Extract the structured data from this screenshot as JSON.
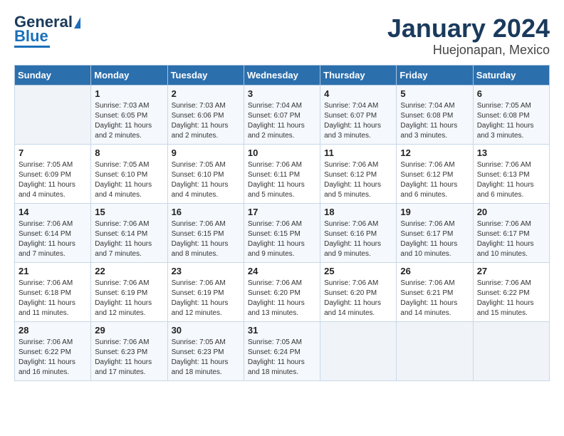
{
  "header": {
    "logo_line1": "General",
    "logo_line2": "Blue",
    "title": "January 2024",
    "subtitle": "Huejonapan, Mexico"
  },
  "calendar": {
    "headers": [
      "Sunday",
      "Monday",
      "Tuesday",
      "Wednesday",
      "Thursday",
      "Friday",
      "Saturday"
    ],
    "weeks": [
      [
        {
          "day": "",
          "info": ""
        },
        {
          "day": "1",
          "info": "Sunrise: 7:03 AM\nSunset: 6:05 PM\nDaylight: 11 hours\nand 2 minutes."
        },
        {
          "day": "2",
          "info": "Sunrise: 7:03 AM\nSunset: 6:06 PM\nDaylight: 11 hours\nand 2 minutes."
        },
        {
          "day": "3",
          "info": "Sunrise: 7:04 AM\nSunset: 6:07 PM\nDaylight: 11 hours\nand 2 minutes."
        },
        {
          "day": "4",
          "info": "Sunrise: 7:04 AM\nSunset: 6:07 PM\nDaylight: 11 hours\nand 3 minutes."
        },
        {
          "day": "5",
          "info": "Sunrise: 7:04 AM\nSunset: 6:08 PM\nDaylight: 11 hours\nand 3 minutes."
        },
        {
          "day": "6",
          "info": "Sunrise: 7:05 AM\nSunset: 6:08 PM\nDaylight: 11 hours\nand 3 minutes."
        }
      ],
      [
        {
          "day": "7",
          "info": "Sunrise: 7:05 AM\nSunset: 6:09 PM\nDaylight: 11 hours\nand 4 minutes."
        },
        {
          "day": "8",
          "info": "Sunrise: 7:05 AM\nSunset: 6:10 PM\nDaylight: 11 hours\nand 4 minutes."
        },
        {
          "day": "9",
          "info": "Sunrise: 7:05 AM\nSunset: 6:10 PM\nDaylight: 11 hours\nand 4 minutes."
        },
        {
          "day": "10",
          "info": "Sunrise: 7:06 AM\nSunset: 6:11 PM\nDaylight: 11 hours\nand 5 minutes."
        },
        {
          "day": "11",
          "info": "Sunrise: 7:06 AM\nSunset: 6:12 PM\nDaylight: 11 hours\nand 5 minutes."
        },
        {
          "day": "12",
          "info": "Sunrise: 7:06 AM\nSunset: 6:12 PM\nDaylight: 11 hours\nand 6 minutes."
        },
        {
          "day": "13",
          "info": "Sunrise: 7:06 AM\nSunset: 6:13 PM\nDaylight: 11 hours\nand 6 minutes."
        }
      ],
      [
        {
          "day": "14",
          "info": "Sunrise: 7:06 AM\nSunset: 6:14 PM\nDaylight: 11 hours\nand 7 minutes."
        },
        {
          "day": "15",
          "info": "Sunrise: 7:06 AM\nSunset: 6:14 PM\nDaylight: 11 hours\nand 7 minutes."
        },
        {
          "day": "16",
          "info": "Sunrise: 7:06 AM\nSunset: 6:15 PM\nDaylight: 11 hours\nand 8 minutes."
        },
        {
          "day": "17",
          "info": "Sunrise: 7:06 AM\nSunset: 6:15 PM\nDaylight: 11 hours\nand 9 minutes."
        },
        {
          "day": "18",
          "info": "Sunrise: 7:06 AM\nSunset: 6:16 PM\nDaylight: 11 hours\nand 9 minutes."
        },
        {
          "day": "19",
          "info": "Sunrise: 7:06 AM\nSunset: 6:17 PM\nDaylight: 11 hours\nand 10 minutes."
        },
        {
          "day": "20",
          "info": "Sunrise: 7:06 AM\nSunset: 6:17 PM\nDaylight: 11 hours\nand 10 minutes."
        }
      ],
      [
        {
          "day": "21",
          "info": "Sunrise: 7:06 AM\nSunset: 6:18 PM\nDaylight: 11 hours\nand 11 minutes."
        },
        {
          "day": "22",
          "info": "Sunrise: 7:06 AM\nSunset: 6:19 PM\nDaylight: 11 hours\nand 12 minutes."
        },
        {
          "day": "23",
          "info": "Sunrise: 7:06 AM\nSunset: 6:19 PM\nDaylight: 11 hours\nand 12 minutes."
        },
        {
          "day": "24",
          "info": "Sunrise: 7:06 AM\nSunset: 6:20 PM\nDaylight: 11 hours\nand 13 minutes."
        },
        {
          "day": "25",
          "info": "Sunrise: 7:06 AM\nSunset: 6:20 PM\nDaylight: 11 hours\nand 14 minutes."
        },
        {
          "day": "26",
          "info": "Sunrise: 7:06 AM\nSunset: 6:21 PM\nDaylight: 11 hours\nand 14 minutes."
        },
        {
          "day": "27",
          "info": "Sunrise: 7:06 AM\nSunset: 6:22 PM\nDaylight: 11 hours\nand 15 minutes."
        }
      ],
      [
        {
          "day": "28",
          "info": "Sunrise: 7:06 AM\nSunset: 6:22 PM\nDaylight: 11 hours\nand 16 minutes."
        },
        {
          "day": "29",
          "info": "Sunrise: 7:06 AM\nSunset: 6:23 PM\nDaylight: 11 hours\nand 17 minutes."
        },
        {
          "day": "30",
          "info": "Sunrise: 7:05 AM\nSunset: 6:23 PM\nDaylight: 11 hours\nand 18 minutes."
        },
        {
          "day": "31",
          "info": "Sunrise: 7:05 AM\nSunset: 6:24 PM\nDaylight: 11 hours\nand 18 minutes."
        },
        {
          "day": "",
          "info": ""
        },
        {
          "day": "",
          "info": ""
        },
        {
          "day": "",
          "info": ""
        }
      ]
    ]
  }
}
